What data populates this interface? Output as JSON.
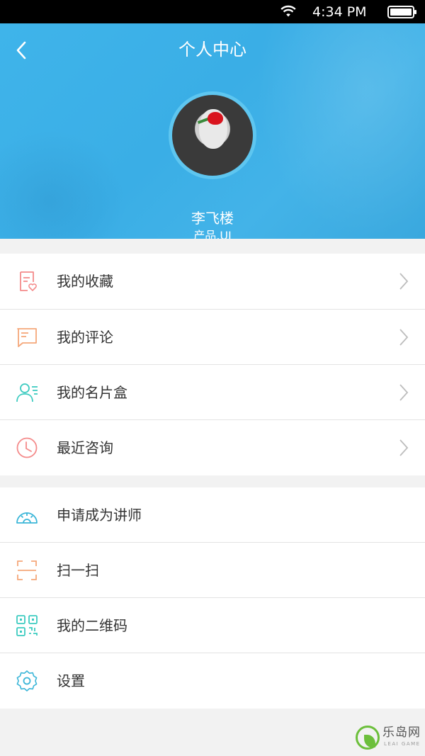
{
  "status_bar": {
    "time": "4:34 PM"
  },
  "header": {
    "title": "个人中心"
  },
  "profile": {
    "name": "李飞楼",
    "role": "产品,UI"
  },
  "menu_group_1": [
    {
      "label": "我的收藏",
      "icon": "favorites-icon"
    },
    {
      "label": "我的评论",
      "icon": "comment-icon"
    },
    {
      "label": "我的名片盒",
      "icon": "contacts-icon"
    },
    {
      "label": "最近咨询",
      "icon": "clock-icon"
    }
  ],
  "menu_group_2": [
    {
      "label": "申请成为讲师",
      "icon": "lecturer-icon"
    },
    {
      "label": "扫一扫",
      "icon": "scan-icon"
    },
    {
      "label": "我的二维码",
      "icon": "qr-code-icon"
    },
    {
      "label": "设置",
      "icon": "gear-icon"
    }
  ],
  "watermark": {
    "name": "乐岛网",
    "sub": "LEAI GAME"
  },
  "colors": {
    "header_blue": "#3fb4ea",
    "accent_pink": "#f48b8b",
    "accent_orange": "#f5a77a",
    "accent_teal": "#3ccbc0",
    "accent_cyan": "#3bb6d8"
  }
}
